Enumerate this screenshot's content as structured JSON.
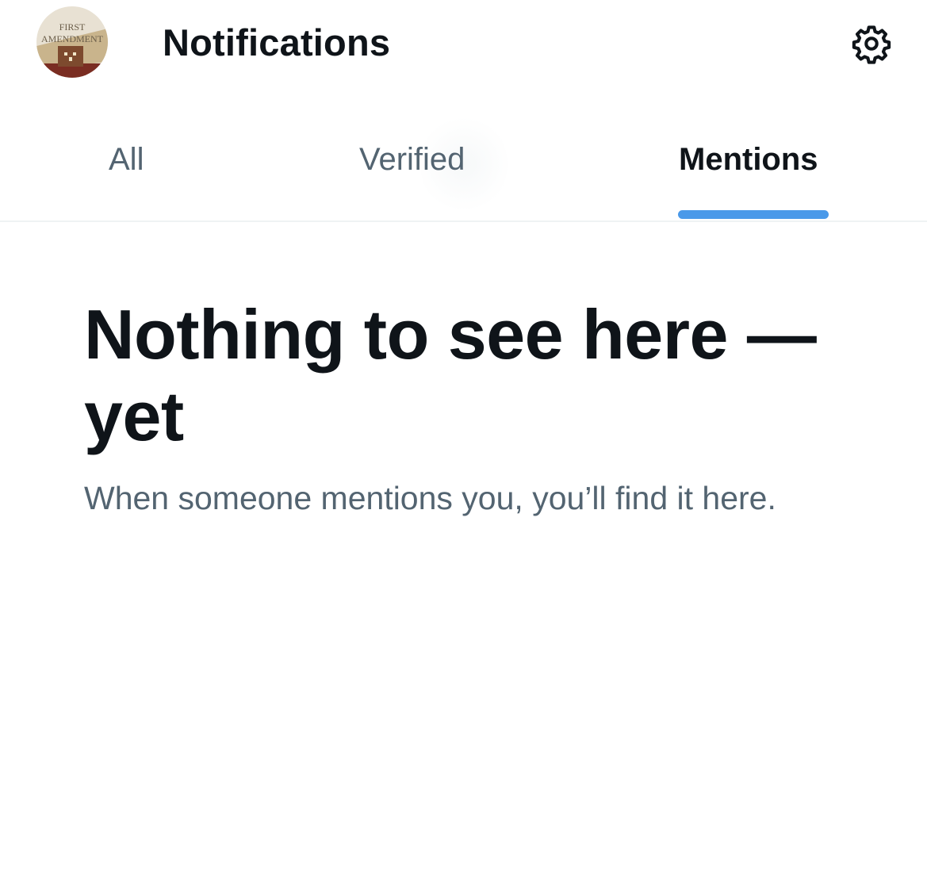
{
  "header": {
    "title": "Notifications",
    "avatar": {
      "text_line1": "FIRST",
      "text_line2": "AMENDMENT"
    },
    "settings_icon": "gear-icon"
  },
  "tabs": [
    {
      "label": "All",
      "selected": false
    },
    {
      "label": "Verified",
      "selected": false
    },
    {
      "label": "Mentions",
      "selected": true
    }
  ],
  "empty_state": {
    "title": "Nothing to see here — yet",
    "subtitle": "When someone mentions you, you’ll find it here."
  },
  "colors": {
    "text_primary": "#0f1419",
    "text_secondary": "#536471",
    "accent": "#4a99e9",
    "divider": "#eff3f4"
  }
}
